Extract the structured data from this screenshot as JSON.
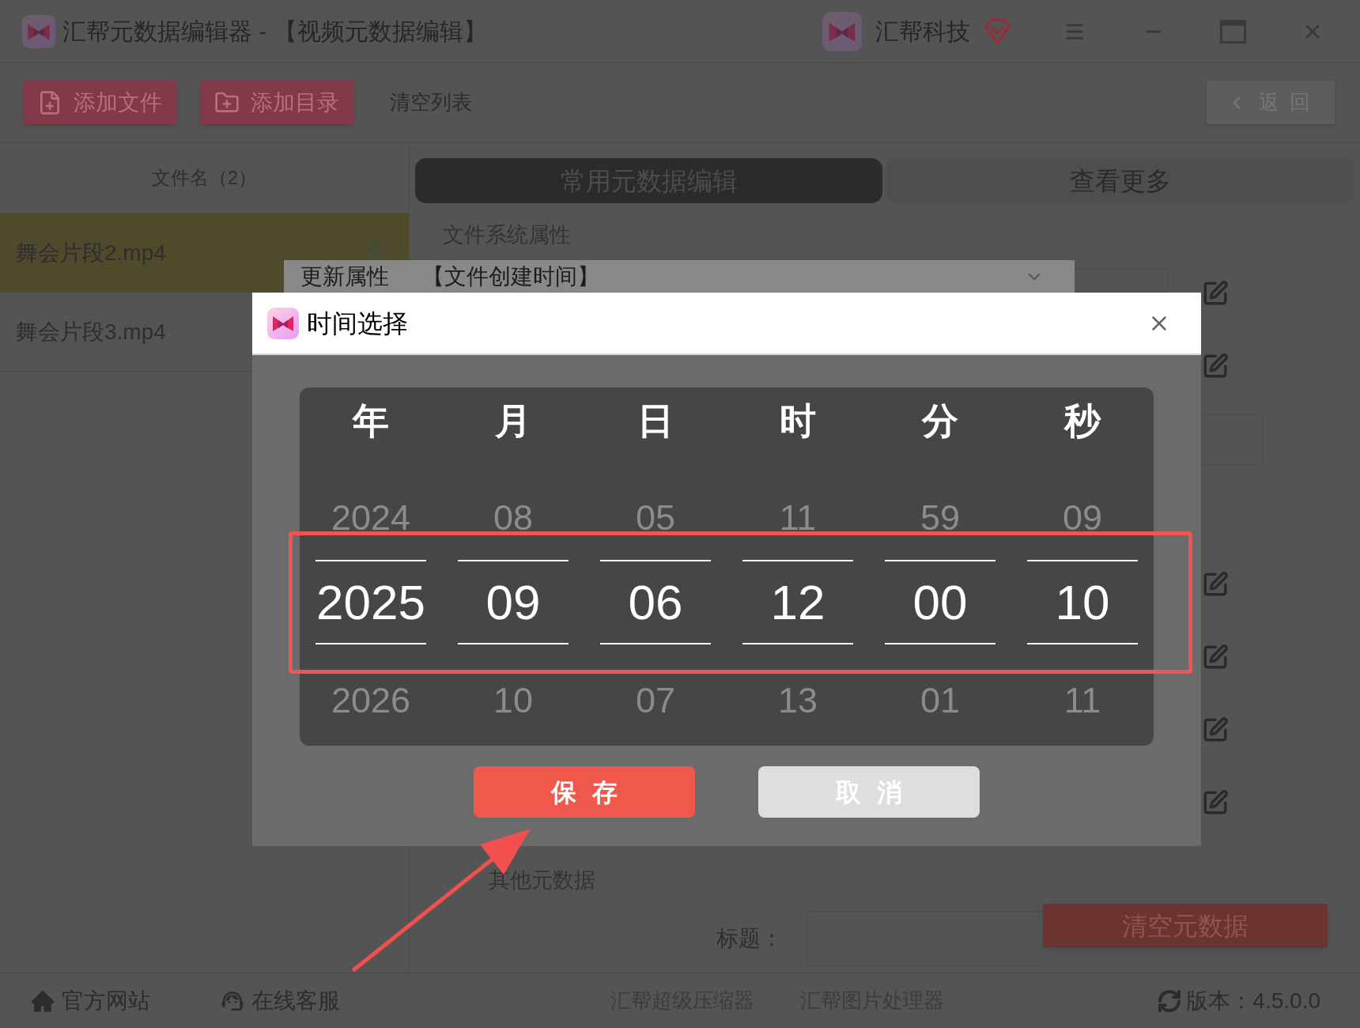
{
  "window": {
    "title": "汇帮元数据编辑器 - 【视频元数据编辑】",
    "brand": "汇帮科技"
  },
  "toolbar": {
    "buttons": [
      {
        "kind": "add-file",
        "label": "添加文件"
      },
      {
        "kind": "add-folder",
        "label": "添加目录"
      },
      {
        "kind": "text",
        "label": "清空列表"
      }
    ],
    "back": {
      "label": "返回"
    }
  },
  "file_list": {
    "header": "文件名（2）",
    "files": [
      {
        "name": "舞会片段2.mp4",
        "selected": true
      },
      {
        "name": "舞会片段3.mp4",
        "selected": false
      }
    ]
  },
  "editor": {
    "tabs": [
      {
        "label": "常用元数据编辑",
        "selected": true
      },
      {
        "label": "查看更多",
        "selected": false
      }
    ],
    "sections": [
      "文件系统属性",
      "其他元数据"
    ],
    "dropdown": {
      "label": "更新属性",
      "value": "【文件创建时间】"
    },
    "title_field": {
      "label": "标题："
    },
    "clear_button": {
      "label": "清空元数据"
    }
  },
  "dialog": {
    "title": "时间选择",
    "columns": [
      {
        "header": "年",
        "previous": "2024",
        "value": "2025",
        "next": "2026"
      },
      {
        "header": "月",
        "previous": "08",
        "value": "09",
        "next": "10"
      },
      {
        "header": "日",
        "previous": "05",
        "value": "06",
        "next": "07"
      },
      {
        "header": "时",
        "previous": "11",
        "value": "12",
        "next": "13"
      },
      {
        "header": "分",
        "previous": "59",
        "value": "00",
        "next": "01"
      },
      {
        "header": "秒",
        "previous": "09",
        "value": "10",
        "next": "11"
      }
    ],
    "buttons": [
      {
        "kind": "primary",
        "label": "保存"
      },
      {
        "kind": "secondary",
        "label": "取消"
      }
    ]
  },
  "status_bar": {
    "items": [
      {
        "kind": "home",
        "label": "官方网站"
      },
      {
        "kind": "support",
        "label": "在线客服"
      }
    ],
    "links": [
      "汇帮超级压缩器",
      "汇帮图片处理器"
    ],
    "version": "版本：4.5.0.0"
  },
  "annotations": {
    "highlight_frame": true,
    "arrow": true
  }
}
